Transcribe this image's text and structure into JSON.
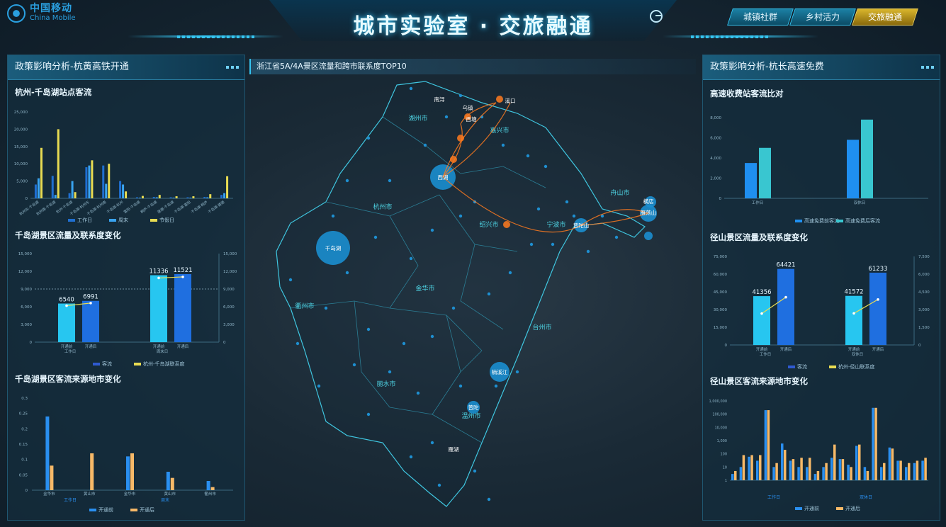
{
  "header": {
    "logo_cn": "中国移动",
    "logo_en": "China Mobile",
    "title": "城市实验室 · 交旅融通",
    "nav": [
      {
        "label": "城镇社群",
        "active": false
      },
      {
        "label": "乡村活力",
        "active": false
      },
      {
        "label": "交旅融通",
        "active": true
      }
    ]
  },
  "left_panel": {
    "title": "政策影响分析-杭黄高铁开通",
    "chart1": {
      "subtitle": "杭州-千岛湖站点客流",
      "type": "bar",
      "yticks": [
        "25,000",
        "20,000",
        "15,000",
        "10,000",
        "5,000",
        "0"
      ],
      "ylim": [
        0,
        25000
      ],
      "categories": [
        "杭州东-千岛湖",
        "杭州南-千岛湖",
        "杭州-千岛湖",
        "千岛湖-杭州东",
        "千岛湖-杭州南",
        "千岛湖-杭州",
        "富阳-千岛湖",
        "桐庐-千岛湖",
        "建德-千岛湖",
        "千岛湖-富阳",
        "千岛湖-桐庐",
        "千岛湖-建德"
      ],
      "series": [
        {
          "name": "工作日",
          "color": "#1f6fd1",
          "values": [
            4000,
            6500,
            1500,
            9000,
            9500,
            5000,
            300,
            400,
            300,
            300,
            400,
            1000
          ]
        },
        {
          "name": "周末",
          "color": "#39a3f0",
          "values": [
            5800,
            1000,
            5000,
            9500,
            4200,
            4000,
            200,
            300,
            200,
            200,
            300,
            1500
          ]
        },
        {
          "name": "节假日",
          "color": "#e8dc52",
          "values": [
            14600,
            20000,
            1800,
            11000,
            10000,
            2000,
            700,
            1000,
            600,
            600,
            1200,
            6400
          ]
        }
      ]
    },
    "chart2": {
      "subtitle": "千岛湖景区流量及联系度变化",
      "type": "bar",
      "yticks_left": [
        "15,000",
        "12,000",
        "9,000",
        "6,000",
        "3,000",
        "0"
      ],
      "yticks_right": [
        "15,000",
        "12,000",
        "9,000",
        "6,000",
        "3,000",
        "0"
      ],
      "ylim": [
        0,
        15000
      ],
      "groups": [
        {
          "name": "工作日",
          "bars": [
            {
              "label": "开通前",
              "value": 6540
            },
            {
              "label": "开通后",
              "value": 6991
            }
          ]
        },
        {
          "name": "周末日",
          "bars": [
            {
              "label": "开通前",
              "value": 11336
            },
            {
              "label": "开通后",
              "value": 11521
            }
          ]
        }
      ],
      "legend": [
        "客流",
        "杭州-千岛湖联系度"
      ],
      "ref_line": 9000
    },
    "chart3": {
      "subtitle": "千岛湖景区客流来源地市变化",
      "type": "bar",
      "yticks": [
        "0.3",
        "0.25",
        "0.2",
        "0.15",
        "0.1",
        "0.05",
        "0"
      ],
      "ylim": [
        0,
        0.3
      ],
      "categories": [
        "金华市",
        "黄山市",
        "金华市",
        "黄山市",
        "衢州市"
      ],
      "groups": [
        "工作日",
        "周末"
      ],
      "series": [
        {
          "name": "开通前",
          "color": "#2a8ff0",
          "values": [
            0.24,
            0,
            0.11,
            0.06,
            0.03
          ]
        },
        {
          "name": "开通后",
          "color": "#f7b968",
          "values": [
            0.08,
            0.12,
            0.12,
            0.04,
            0.01
          ]
        }
      ]
    }
  },
  "map": {
    "title": "浙江省5A/4A景区流量和跨市联系度TOP10",
    "cities": [
      "湖州市",
      "嘉兴市",
      "杭州市",
      "绍兴市",
      "宁波市",
      "舟山市",
      "衢州市",
      "金华市",
      "台州市",
      "丽水市",
      "温州市"
    ],
    "spots": [
      "西湖",
      "千岛湖",
      "乌镇",
      "西塘",
      "南浔",
      "溪口",
      "普陀山",
      "横店",
      "雁荡山",
      "楠溪江",
      "普陀",
      "雁湖"
    ]
  },
  "right_panel": {
    "title": "政策影响分析-杭长高速免费",
    "chart1": {
      "subtitle": "高速收费站客流比对",
      "type": "bar",
      "yticks": [
        "8,000",
        "6,000",
        "4,000",
        "2,000",
        "0"
      ],
      "ylim": [
        0,
        8000
      ],
      "categories": [
        "工作日",
        "双休日"
      ],
      "series": [
        {
          "name": "高速免费前客流",
          "color": "#1f8ff0",
          "values": [
            3500,
            5800
          ]
        },
        {
          "name": "高速免费后客流",
          "color": "#39c6d0",
          "values": [
            5000,
            7800
          ]
        }
      ]
    },
    "chart2": {
      "subtitle": "径山景区流量及联系度变化",
      "type": "bar",
      "yticks_left": [
        "75,000",
        "60,000",
        "45,000",
        "30,000",
        "15,000",
        "0"
      ],
      "yticks_right": [
        "7,500",
        "6,000",
        "4,500",
        "3,000",
        "1,500",
        "0"
      ],
      "ylim": [
        0,
        75000
      ],
      "groups": [
        {
          "name": "工作日",
          "bars": [
            {
              "label": "开通前",
              "value": 41356
            },
            {
              "label": "开通后",
              "value": 64421
            }
          ]
        },
        {
          "name": "双休日",
          "bars": [
            {
              "label": "开通前",
              "value": 41572
            },
            {
              "label": "开通后",
              "value": 61233
            }
          ]
        }
      ],
      "legend": [
        "客流",
        "杭州-径山联系度"
      ]
    },
    "chart3": {
      "subtitle": "径山景区客流来源地市变化",
      "type": "bar",
      "yticks": [
        "1,000,000",
        "100,000",
        "10,000",
        "1,000",
        "100",
        "10",
        "1"
      ],
      "log_scale": true,
      "groups": [
        "工作日",
        "双休日"
      ],
      "series": [
        {
          "name": "开通前",
          "color": "#2a8ff0",
          "values": [
            3,
            10,
            60,
            30,
            200000,
            10,
            600,
            30,
            10,
            10,
            3,
            10,
            50,
            40,
            15,
            400,
            10,
            300000,
            10,
            300,
            30,
            10,
            20,
            30
          ]
        },
        {
          "name": "开通后",
          "color": "#f7b968",
          "values": [
            5,
            80,
            80,
            80,
            200000,
            20,
            200,
            40,
            50,
            50,
            5,
            20,
            500,
            40,
            10,
            500,
            5,
            300000,
            20,
            250,
            30,
            20,
            30,
            50
          ]
        }
      ],
      "legend": [
        "开通前",
        "开通后"
      ]
    }
  }
}
